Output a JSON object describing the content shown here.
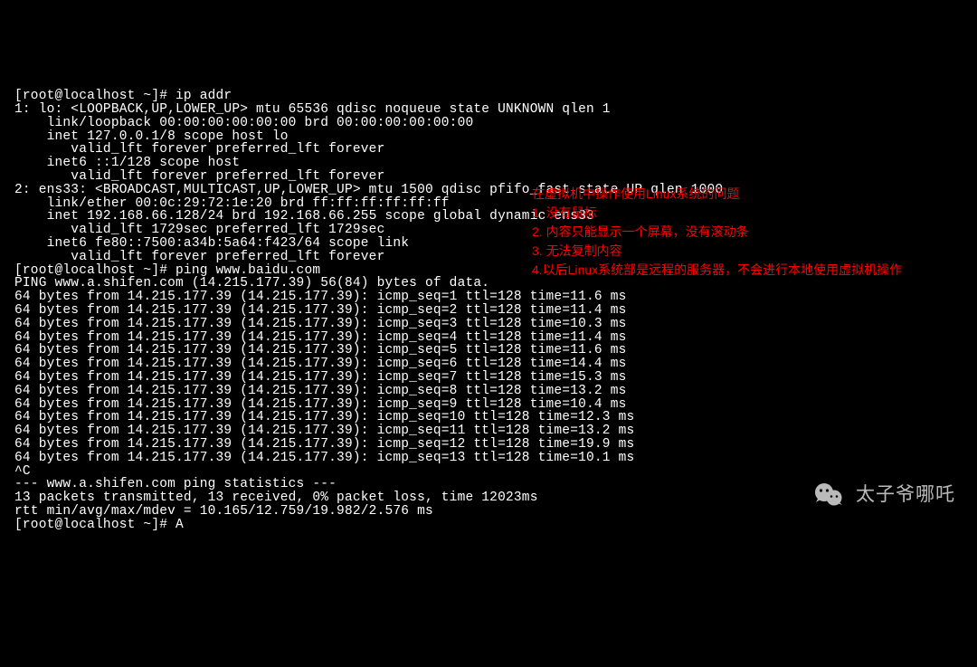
{
  "terminal": {
    "lines": [
      "[root@localhost ~]# ip addr",
      "1: lo: <LOOPBACK,UP,LOWER_UP> mtu 65536 qdisc noqueue state UNKNOWN qlen 1",
      "    link/loopback 00:00:00:00:00:00 brd 00:00:00:00:00:00",
      "    inet 127.0.0.1/8 scope host lo",
      "       valid_lft forever preferred_lft forever",
      "    inet6 ::1/128 scope host",
      "       valid_lft forever preferred_lft forever",
      "2: ens33: <BROADCAST,MULTICAST,UP,LOWER_UP> mtu 1500 qdisc pfifo_fast state UP qlen 1000",
      "    link/ether 00:0c:29:72:1e:20 brd ff:ff:ff:ff:ff:ff",
      "    inet 192.168.66.128/24 brd 192.168.66.255 scope global dynamic ens33",
      "       valid_lft 1729sec preferred_lft 1729sec",
      "    inet6 fe80::7500:a34b:5a64:f423/64 scope link",
      "       valid_lft forever preferred_lft forever",
      "[root@localhost ~]# ping www.baidu.com",
      "PING www.a.shifen.com (14.215.177.39) 56(84) bytes of data.",
      "64 bytes from 14.215.177.39 (14.215.177.39): icmp_seq=1 ttl=128 time=11.6 ms",
      "64 bytes from 14.215.177.39 (14.215.177.39): icmp_seq=2 ttl=128 time=11.4 ms",
      "64 bytes from 14.215.177.39 (14.215.177.39): icmp_seq=3 ttl=128 time=10.3 ms",
      "64 bytes from 14.215.177.39 (14.215.177.39): icmp_seq=4 ttl=128 time=11.4 ms",
      "64 bytes from 14.215.177.39 (14.215.177.39): icmp_seq=5 ttl=128 time=11.6 ms",
      "64 bytes from 14.215.177.39 (14.215.177.39): icmp_seq=6 ttl=128 time=14.4 ms",
      "64 bytes from 14.215.177.39 (14.215.177.39): icmp_seq=7 ttl=128 time=15.3 ms",
      "64 bytes from 14.215.177.39 (14.215.177.39): icmp_seq=8 ttl=128 time=13.2 ms",
      "64 bytes from 14.215.177.39 (14.215.177.39): icmp_seq=9 ttl=128 time=10.4 ms",
      "64 bytes from 14.215.177.39 (14.215.177.39): icmp_seq=10 ttl=128 time=12.3 ms",
      "64 bytes from 14.215.177.39 (14.215.177.39): icmp_seq=11 ttl=128 time=13.2 ms",
      "64 bytes from 14.215.177.39 (14.215.177.39): icmp_seq=12 ttl=128 time=19.9 ms",
      "64 bytes from 14.215.177.39 (14.215.177.39): icmp_seq=13 ttl=128 time=10.1 ms",
      "^C",
      "--- www.a.shifen.com ping statistics ---",
      "13 packets transmitted, 13 received, 0% packet loss, time 12023ms",
      "rtt min/avg/max/mdev = 10.165/12.759/19.982/2.576 ms",
      "[root@localhost ~]# A"
    ]
  },
  "annotations": {
    "title": "在虚拟机中操作使用Linux系统的问题",
    "items": [
      "1. 没有鼠标",
      "2. 内容只能显示一个屏幕，没有滚动条",
      "3. 无法复制内容",
      "4.以后Linux系统部是远程的服务器，不会进行本地使用虚拟机操作"
    ]
  },
  "watermark": {
    "text": "太子爷哪吒"
  }
}
